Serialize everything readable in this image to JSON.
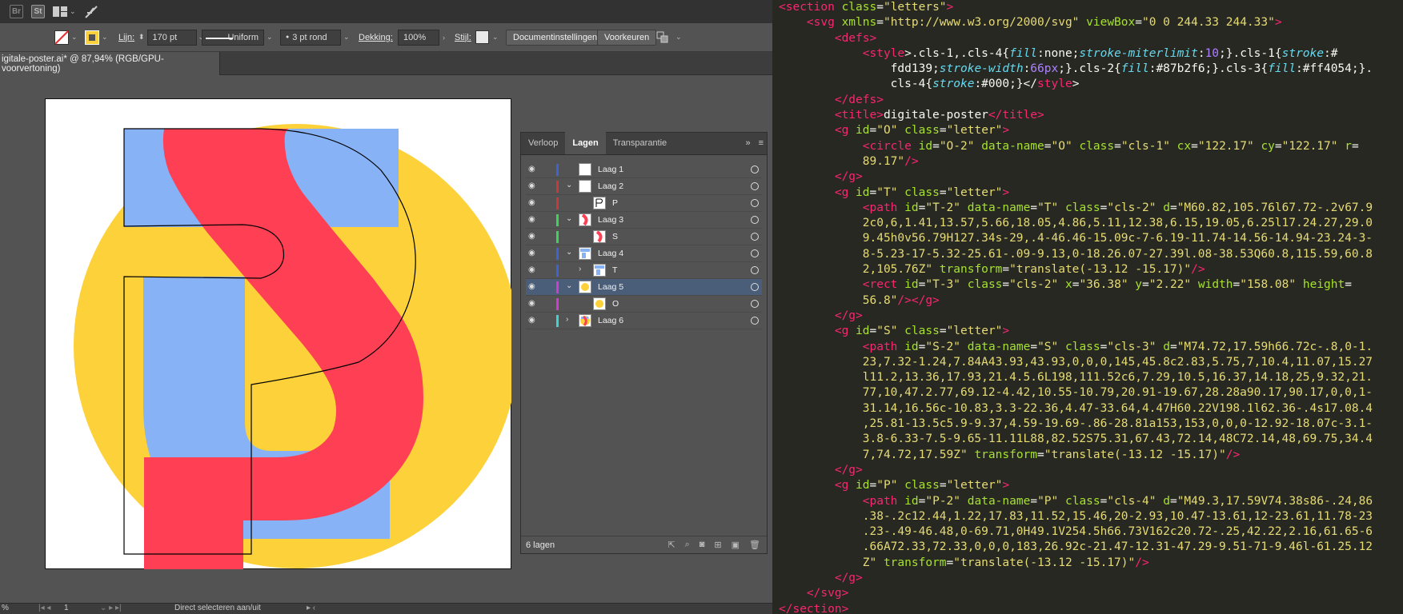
{
  "appbar": {
    "bridge_label": "Br",
    "stock_label": "St"
  },
  "controlbar": {
    "stroke_label": "Lijn:",
    "stroke_value": "170 pt",
    "stroke_profile": "Uniform",
    "brush": "3 pt rond",
    "opacity_label": "Dekking:",
    "opacity_value": "100%",
    "style_label": "Stijl:",
    "doc_settings_button": "Documentinstellingen",
    "preferences_button": "Voorkeuren"
  },
  "document_tab": {
    "title": "igitale-poster.ai* @ 87,94% (RGB/GPU-voorvertoning)"
  },
  "artwork_colors": {
    "yellow": "#fdd139",
    "blue": "#87b2f6",
    "red": "#ff4054",
    "black": "#000000"
  },
  "layers_panel": {
    "tabs": [
      "Verloop",
      "Lagen",
      "Transparantie"
    ],
    "active_tab": "Lagen",
    "rows": [
      {
        "name": "Laag 1",
        "color": "#3d63d6",
        "indent": 0,
        "expand": "",
        "selected": false,
        "thumb": "blank"
      },
      {
        "name": "Laag 2",
        "color": "#c83a3a",
        "indent": 0,
        "expand": "⌄",
        "selected": false,
        "thumb": "blank"
      },
      {
        "name": "P",
        "color": "#c83a3a",
        "indent": 1,
        "expand": "",
        "selected": false,
        "thumb": "p"
      },
      {
        "name": "Laag 3",
        "color": "#3bd35a",
        "indent": 0,
        "expand": "⌄",
        "selected": false,
        "thumb": "s"
      },
      {
        "name": "S",
        "color": "#3bd35a",
        "indent": 1,
        "expand": "",
        "selected": false,
        "thumb": "s"
      },
      {
        "name": "Laag 4",
        "color": "#3d63d6",
        "indent": 0,
        "expand": "⌄",
        "selected": false,
        "thumb": "t"
      },
      {
        "name": "T",
        "color": "#3d63d6",
        "indent": 1,
        "expand": "›",
        "selected": false,
        "thumb": "t"
      },
      {
        "name": "Laag 5",
        "color": "#d13bd1",
        "indent": 0,
        "expand": "⌄",
        "selected": true,
        "thumb": "o"
      },
      {
        "name": "O",
        "color": "#d13bd1",
        "indent": 1,
        "expand": "",
        "selected": false,
        "thumb": "o"
      },
      {
        "name": "Laag 6",
        "color": "#3bd3d3",
        "indent": 0,
        "expand": "›",
        "selected": false,
        "thumb": "all"
      }
    ],
    "footer": "6 lagen"
  },
  "statusbar": {
    "zoom": "%",
    "page": "1",
    "tool_hint": "Direct selecteren aan/uit"
  },
  "code_lines": [
    [
      [
        "t",
        "<section "
      ],
      [
        "a",
        "class"
      ],
      [
        "w",
        "="
      ],
      [
        "s",
        "\"letters\""
      ],
      [
        "t",
        ">"
      ]
    ],
    [
      [
        "w",
        "    "
      ],
      [
        "t",
        "<svg "
      ],
      [
        "a",
        "xmlns"
      ],
      [
        "w",
        "="
      ],
      [
        "s",
        "\"http://www.w3.org/2000/svg\" "
      ],
      [
        "a",
        "viewBox"
      ],
      [
        "w",
        "="
      ],
      [
        "s",
        "\"0 0 244.33 244.33\""
      ],
      [
        "t",
        ">"
      ]
    ],
    [
      [
        "w",
        "        "
      ],
      [
        "t",
        "<defs>"
      ]
    ],
    [
      [
        "w",
        "            "
      ],
      [
        "t",
        "<style"
      ],
      [
        "w",
        ">.cls-1,.cls-4{"
      ],
      [
        "k",
        "fill"
      ],
      [
        "w",
        ":none;"
      ],
      [
        "k",
        "stroke-miterlimit"
      ],
      [
        "w",
        ":"
      ],
      [
        "p",
        "10"
      ],
      [
        "w",
        ";}.cls-1{"
      ],
      [
        "k",
        "stroke"
      ],
      [
        "w",
        ":#"
      ]
    ],
    [
      [
        "w",
        "                fdd139;"
      ],
      [
        "k",
        "stroke-width"
      ],
      [
        "w",
        ":"
      ],
      [
        "p",
        "66px"
      ],
      [
        "w",
        ";}.cls-2{"
      ],
      [
        "k",
        "fill"
      ],
      [
        "w",
        ":#87b2f6;}.cls-3{"
      ],
      [
        "k",
        "fill"
      ],
      [
        "w",
        ":#ff4054;}."
      ]
    ],
    [
      [
        "w",
        "                cls-4{"
      ],
      [
        "k",
        "stroke"
      ],
      [
        "w",
        ":#000;}</"
      ],
      [
        "t",
        "style"
      ],
      [
        "w",
        ">"
      ]
    ],
    [
      [
        "w",
        "        "
      ],
      [
        "t",
        "</defs>"
      ]
    ],
    [
      [
        "w",
        "        "
      ],
      [
        "t",
        "<title>"
      ],
      [
        "w",
        "digitale-poster"
      ],
      [
        "t",
        "</title>"
      ]
    ],
    [
      [
        "w",
        "        "
      ],
      [
        "t",
        "<g "
      ],
      [
        "a",
        "id"
      ],
      [
        "w",
        "="
      ],
      [
        "s",
        "\"O\" "
      ],
      [
        "a",
        "class"
      ],
      [
        "w",
        "="
      ],
      [
        "s",
        "\"letter\""
      ],
      [
        "t",
        ">"
      ]
    ],
    [
      [
        "w",
        "            "
      ],
      [
        "t",
        "<circle "
      ],
      [
        "a",
        "id"
      ],
      [
        "w",
        "="
      ],
      [
        "s",
        "\"O-2\" "
      ],
      [
        "a",
        "data-name"
      ],
      [
        "w",
        "="
      ],
      [
        "s",
        "\"O\" "
      ],
      [
        "a",
        "class"
      ],
      [
        "w",
        "="
      ],
      [
        "s",
        "\"cls-1\" "
      ],
      [
        "a",
        "cx"
      ],
      [
        "w",
        "="
      ],
      [
        "s",
        "\"122.17\" "
      ],
      [
        "a",
        "cy"
      ],
      [
        "w",
        "="
      ],
      [
        "s",
        "\"122.17\" "
      ],
      [
        "a",
        "r"
      ],
      [
        "w",
        "="
      ]
    ],
    [
      [
        "s",
        "            89.17\""
      ],
      [
        "t",
        "/>"
      ]
    ],
    [
      [
        "w",
        "        "
      ],
      [
        "t",
        "</g>"
      ]
    ],
    [
      [
        "w",
        "        "
      ],
      [
        "t",
        "<g "
      ],
      [
        "a",
        "id"
      ],
      [
        "w",
        "="
      ],
      [
        "s",
        "\"T\" "
      ],
      [
        "a",
        "class"
      ],
      [
        "w",
        "="
      ],
      [
        "s",
        "\"letter\""
      ],
      [
        "t",
        ">"
      ]
    ],
    [
      [
        "w",
        "            "
      ],
      [
        "t",
        "<path "
      ],
      [
        "a",
        "id"
      ],
      [
        "w",
        "="
      ],
      [
        "s",
        "\"T-2\" "
      ],
      [
        "a",
        "data-name"
      ],
      [
        "w",
        "="
      ],
      [
        "s",
        "\"T\" "
      ],
      [
        "a",
        "class"
      ],
      [
        "w",
        "="
      ],
      [
        "s",
        "\"cls-2\" "
      ],
      [
        "a",
        "d"
      ],
      [
        "w",
        "="
      ],
      [
        "s",
        "\"M60.82,105.76l67.72-.2v67.9"
      ]
    ],
    [
      [
        "s",
        "            2c0,6,1.41,13.57,5.66,18.05,4.86,5.11,12.38,6.15,19.05,6.25l17.24.27,29.0"
      ]
    ],
    [
      [
        "s",
        "            9.45h0v56.79H127.34s-29,.4-46.46-15.09c-7-6.19-11.74-14.56-14.94-23.24-3-"
      ]
    ],
    [
      [
        "s",
        "            8-5.23-17-5.32-25.61-.09-9.13,0-18.26.07-27.39l.08-38.53Q60.8,115.59,60.8"
      ]
    ],
    [
      [
        "s",
        "            2,105.76Z\" "
      ],
      [
        "a",
        "transform"
      ],
      [
        "w",
        "="
      ],
      [
        "s",
        "\"translate(-13.12 -15.17)\""
      ],
      [
        "t",
        "/>"
      ]
    ],
    [
      [
        "w",
        "            "
      ],
      [
        "t",
        "<rect "
      ],
      [
        "a",
        "id"
      ],
      [
        "w",
        "="
      ],
      [
        "s",
        "\"T-3\" "
      ],
      [
        "a",
        "class"
      ],
      [
        "w",
        "="
      ],
      [
        "s",
        "\"cls-2\" "
      ],
      [
        "a",
        "x"
      ],
      [
        "w",
        "="
      ],
      [
        "s",
        "\"36.38\" "
      ],
      [
        "a",
        "y"
      ],
      [
        "w",
        "="
      ],
      [
        "s",
        "\"2.22\" "
      ],
      [
        "a",
        "width"
      ],
      [
        "w",
        "="
      ],
      [
        "s",
        "\"158.08\" "
      ],
      [
        "a",
        "height"
      ],
      [
        "w",
        "="
      ]
    ],
    [
      [
        "s",
        "            56.8\""
      ],
      [
        "t",
        "/></g>"
      ]
    ],
    [
      [
        "w",
        "        "
      ],
      [
        "t",
        "</g>"
      ]
    ],
    [
      [
        "w",
        "        "
      ],
      [
        "t",
        "<g "
      ],
      [
        "a",
        "id"
      ],
      [
        "w",
        "="
      ],
      [
        "s",
        "\"S\" "
      ],
      [
        "a",
        "class"
      ],
      [
        "w",
        "="
      ],
      [
        "s",
        "\"letter\""
      ],
      [
        "t",
        ">"
      ]
    ],
    [
      [
        "w",
        "            "
      ],
      [
        "t",
        "<path "
      ],
      [
        "a",
        "id"
      ],
      [
        "w",
        "="
      ],
      [
        "s",
        "\"S-2\" "
      ],
      [
        "a",
        "data-name"
      ],
      [
        "w",
        "="
      ],
      [
        "s",
        "\"S\" "
      ],
      [
        "a",
        "class"
      ],
      [
        "w",
        "="
      ],
      [
        "s",
        "\"cls-3\" "
      ],
      [
        "a",
        "d"
      ],
      [
        "w",
        "="
      ],
      [
        "s",
        "\"M74.72,17.59h66.72c-.8,0-1."
      ]
    ],
    [
      [
        "s",
        "            23,7.32-1.24,7.84A43.93,43.93,0,0,0,145,45.8c2.83,5.75,7,10.4,11.07,15.27"
      ]
    ],
    [
      [
        "s",
        "            l11.2,13.36,17.93,21.4.5.6L198,111.52c6,7.29,10.5,16.37,14.18,25,9.32,21."
      ]
    ],
    [
      [
        "s",
        "            77,10,47.2.77,69.12-4.42,10.55-10.79,20.91-19.67,28.28a90.17,90.17,0,0,1-"
      ]
    ],
    [
      [
        "s",
        "            31.14,16.56c-10.83,3.3-22.36,4.47-33.64,4.47H60.22V198.1l62.36-.4s17.08.4"
      ]
    ],
    [
      [
        "s",
        "            ,25.81-13.5c5.9-9.37,4.59-19.69-.86-28.81a153,153,0,0,0-12.92-18.07c-3.1-"
      ]
    ],
    [
      [
        "s",
        "            3.8-6.33-7.5-9.65-11.11L88,82.52S75.31,67.43,72.14,48C72.14,48,69.75,34.4"
      ]
    ],
    [
      [
        "s",
        "            7,74.72,17.59Z\" "
      ],
      [
        "a",
        "transform"
      ],
      [
        "w",
        "="
      ],
      [
        "s",
        "\"translate(-13.12 -15.17)\""
      ],
      [
        "t",
        "/>"
      ]
    ],
    [
      [
        "w",
        "        "
      ],
      [
        "t",
        "</g>"
      ]
    ],
    [
      [
        "w",
        "        "
      ],
      [
        "t",
        "<g "
      ],
      [
        "a",
        "id"
      ],
      [
        "w",
        "="
      ],
      [
        "s",
        "\"P\" "
      ],
      [
        "a",
        "class"
      ],
      [
        "w",
        "="
      ],
      [
        "s",
        "\"letter\""
      ],
      [
        "t",
        ">"
      ]
    ],
    [
      [
        "w",
        "            "
      ],
      [
        "t",
        "<path "
      ],
      [
        "a",
        "id"
      ],
      [
        "w",
        "="
      ],
      [
        "s",
        "\"P-2\" "
      ],
      [
        "a",
        "data-name"
      ],
      [
        "w",
        "="
      ],
      [
        "s",
        "\"P\" "
      ],
      [
        "a",
        "class"
      ],
      [
        "w",
        "="
      ],
      [
        "s",
        "\"cls-4\" "
      ],
      [
        "a",
        "d"
      ],
      [
        "w",
        "="
      ],
      [
        "s",
        "\"M49.3,17.59V74.38s86-.24,86"
      ]
    ],
    [
      [
        "s",
        "            .38-.2c12.44,1.22,17.83,11.52,15.46,20-2.93,10.47-13.61,12-23.61,11.78-23"
      ]
    ],
    [
      [
        "s",
        "            .23-.49-46.48,0-69.71,0H49.1V254.5h66.73V162c20.72-.25,42.22,2.16,61.65-6"
      ]
    ],
    [
      [
        "s",
        "            .66A72.33,72.33,0,0,0,183,26.92c-21.47-12.31-47.29-9.51-71-9.46l-61.25.12"
      ]
    ],
    [
      [
        "s",
        "            Z\" "
      ],
      [
        "a",
        "transform"
      ],
      [
        "w",
        "="
      ],
      [
        "s",
        "\"translate(-13.12 -15.17)\""
      ],
      [
        "t",
        "/>"
      ]
    ],
    [
      [
        "w",
        "        "
      ],
      [
        "t",
        "</g>"
      ]
    ],
    [
      [
        "w",
        "    "
      ],
      [
        "t",
        "</svg>"
      ]
    ],
    [
      [
        "t",
        "</section>"
      ]
    ]
  ]
}
